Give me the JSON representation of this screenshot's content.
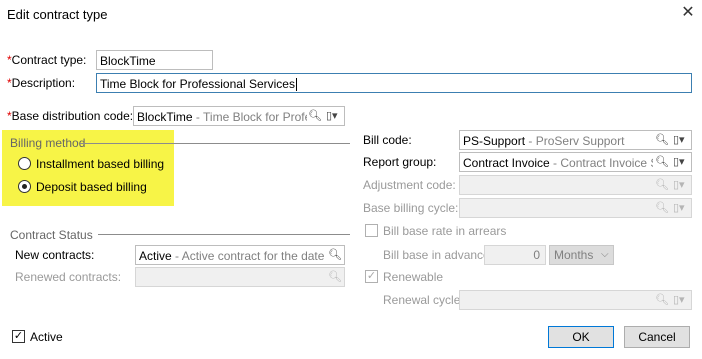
{
  "window": {
    "title": "Edit contract type",
    "close_icon": "✕"
  },
  "fields": {
    "contract_type": {
      "label": "Contract type:",
      "value": "BlockTime"
    },
    "description": {
      "label": "Description:",
      "value": "Time Block for Professional Services"
    },
    "base_distribution": {
      "label": "Base distribution code:",
      "code": "BlockTime",
      "hint": " - Time Block for Professional Services"
    }
  },
  "required_marker": "*",
  "billing_method": {
    "title": "Billing method",
    "options": [
      {
        "label": "Installment based billing",
        "selected": false
      },
      {
        "label": "Deposit based billing",
        "selected": true
      }
    ]
  },
  "right": {
    "bill_code": {
      "label": "Bill code:",
      "code": "PS-Support",
      "hint": " - ProServ Support"
    },
    "report_group": {
      "label": "Report group:",
      "code": "Contract Invoice",
      "hint": " - Contract Invoice System"
    },
    "adjustment_code": {
      "label": "Adjustment code:"
    },
    "base_billing_cycle": {
      "label": "Base billing cycle:"
    },
    "bill_base_rate": {
      "label": "Bill base rate in arrears",
      "checked": false
    },
    "bill_base_advance": {
      "label": "Bill base in advance:",
      "value": "0",
      "unit": "Months"
    },
    "renewable": {
      "label": "Renewable",
      "checked": true
    },
    "renewal_cycle": {
      "label": "Renewal cycle:"
    }
  },
  "contract_status": {
    "title": "Contract Status",
    "new_contracts": {
      "label": "New contracts:",
      "code": "Active",
      "hint": " - Active contract for the date range"
    },
    "renewed_contracts": {
      "label": "Renewed contracts:"
    }
  },
  "footer": {
    "active_label": "Active",
    "active_checked": true,
    "ok": "OK",
    "cancel": "Cancel"
  },
  "colors": {
    "highlight": "#f4f000",
    "required": "#e00000"
  }
}
